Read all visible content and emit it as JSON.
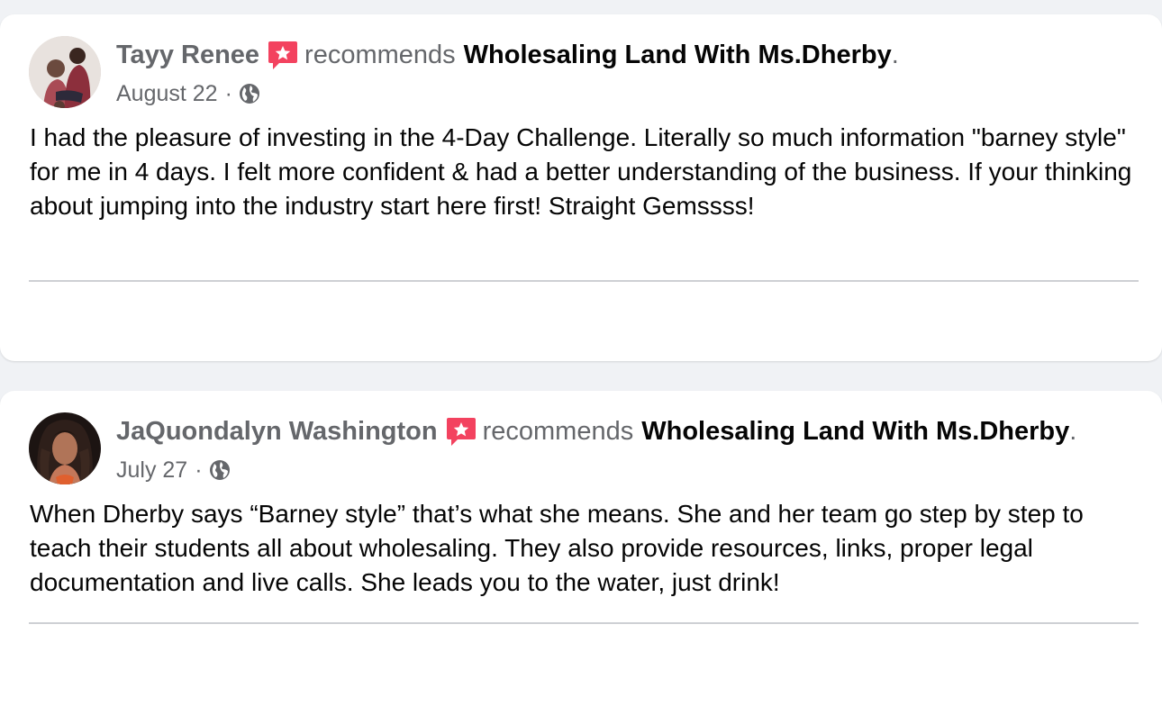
{
  "colors": {
    "page_background": "#f0f2f5",
    "card_background": "#ffffff",
    "secondary_text": "#65676b",
    "primary_text": "#050505",
    "recommend_icon": "#f3425f",
    "divider": "#ced0d4"
  },
  "reviews": [
    {
      "author": "Tayy Renee",
      "recommend_icon": "recommend-star-icon",
      "recommends_word": "recommends",
      "page_name": "Wholesaling Land With Ms.Dherby",
      "period": ".",
      "date": "August 22",
      "separator": "·",
      "audience_icon": "globe-icon",
      "text": "I had the pleasure of investing in the 4-Day Challenge. Literally so much information \"barney style\" for me in 4 days. I felt more confident & had a better understanding of the business. If your thinking about jumping into the industry start here first! Straight Gemssss!"
    },
    {
      "author": "JaQuondalyn Washington",
      "recommend_icon": "recommend-star-icon",
      "recommends_word": "recommends",
      "page_name": "Wholesaling Land With Ms.Dherby",
      "period": ".",
      "date": "July 27",
      "separator": "·",
      "audience_icon": "globe-icon",
      "text": "When Dherby says “Barney style” that’s what she means. She and her team go step by step to teach their students all about wholesaling. They also provide resources, links, proper legal documentation and live calls. She leads you to the water, just drink!"
    }
  ]
}
